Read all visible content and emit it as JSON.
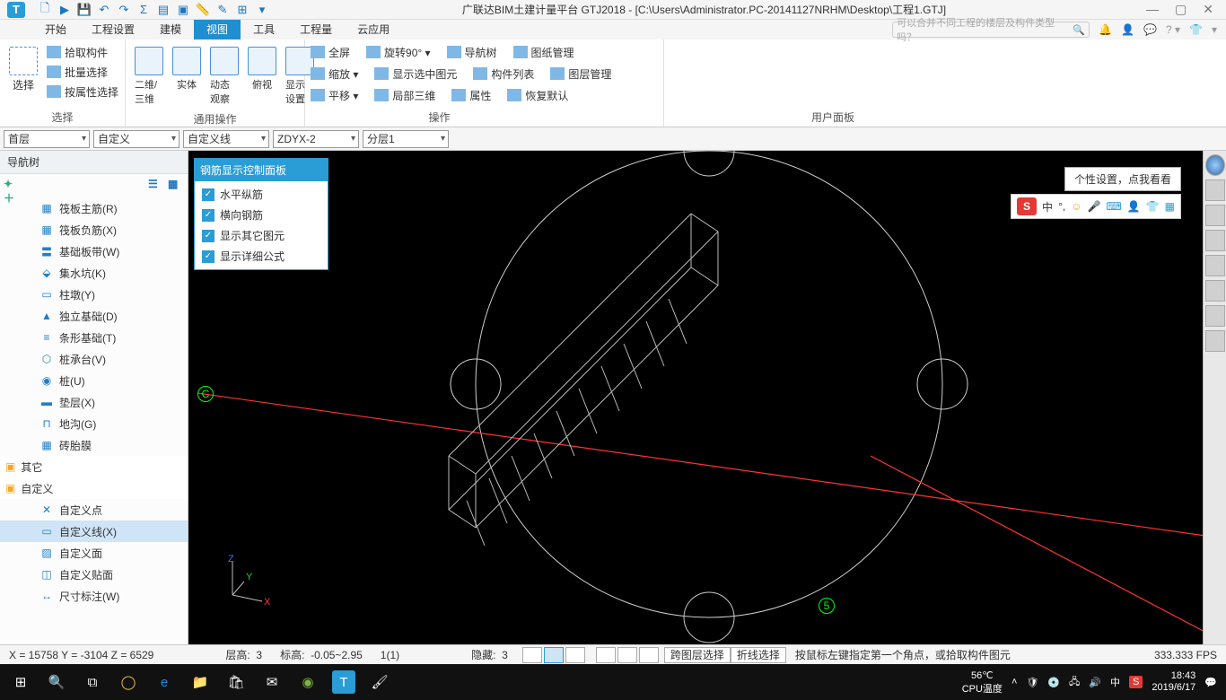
{
  "title": "广联达BIM土建计量平台 GTJ2018 - [C:\\Users\\Administrator.PC-20141127NRHM\\Desktop\\工程1.GTJ]",
  "menu": [
    "开始",
    "工程设置",
    "建模",
    "视图",
    "工具",
    "工程量",
    "云应用"
  ],
  "menu_active": 3,
  "search_placeholder": "可以合并不同工程的楼层及构件类型吗？",
  "ribbon": {
    "g1": {
      "label": "选择",
      "big": "选择",
      "items": [
        "拾取构件",
        "批量选择",
        "按属性选择"
      ]
    },
    "g2": {
      "label": "通用操作",
      "items": [
        "二维/三维",
        "实体",
        "动态观察",
        "俯视",
        "显示设置"
      ]
    },
    "g3": {
      "label": "操作",
      "r1": [
        "全屏",
        "旋转90° ▾",
        "导航树",
        "图纸管理"
      ],
      "r2": [
        "缩放 ▾",
        "显示选中图元",
        "构件列表",
        "图层管理"
      ],
      "r3": [
        "平移 ▾",
        "局部三维",
        "属性",
        "恢复默认"
      ]
    },
    "g4": {
      "label": "用户面板"
    }
  },
  "combos": {
    "floor": "首层",
    "c2": "自定义",
    "c3": "自定义线",
    "c4": "ZDYX-2",
    "c5": "分层1"
  },
  "nav_title": "导航树",
  "tree": [
    {
      "label": "筏板主筋(R)",
      "icon": "▦"
    },
    {
      "label": "筏板负筋(X)",
      "icon": "▦"
    },
    {
      "label": "基础板带(W)",
      "icon": "〓"
    },
    {
      "label": "集水坑(K)",
      "icon": "⬙"
    },
    {
      "label": "柱墩(Y)",
      "icon": "▭"
    },
    {
      "label": "独立基础(D)",
      "icon": "▲"
    },
    {
      "label": "条形基础(T)",
      "icon": "≡"
    },
    {
      "label": "桩承台(V)",
      "icon": "⬡"
    },
    {
      "label": "桩(U)",
      "icon": "◉"
    },
    {
      "label": "垫层(X)",
      "icon": "▬"
    },
    {
      "label": "地沟(G)",
      "icon": "⊓"
    },
    {
      "label": "砖胎膜",
      "icon": "▦"
    }
  ],
  "tree_cat1": "其它",
  "tree_cat2": "自定义",
  "tree2": [
    {
      "label": "自定义点",
      "icon": "✕",
      "sel": false
    },
    {
      "label": "自定义线(X)",
      "icon": "▭",
      "sel": true
    },
    {
      "label": "自定义面",
      "icon": "▨",
      "sel": false
    },
    {
      "label": "自定义贴面",
      "icon": "◫",
      "sel": false
    },
    {
      "label": "尺寸标注(W)",
      "icon": "↔",
      "sel": false
    }
  ],
  "rebar_panel": {
    "title": "钢筋显示控制面板",
    "items": [
      "水平纵筋",
      "横向钢筋",
      "显示其它图元",
      "显示详细公式"
    ]
  },
  "tooltip": "个性设置，点我看看",
  "ime": "中",
  "axis_c": "C",
  "axis_5": "5",
  "gizmo": {
    "x": "X",
    "y": "Y",
    "z": "Z"
  },
  "status": {
    "coords": "X = 15758 Y = -3104 Z = 6529",
    "floor_lbl": "层高:",
    "floor": "3",
    "elev_lbl": "标高:",
    "elev": "-0.05~2.95",
    "sel": "1(1)",
    "hide_lbl": "隐藏:",
    "hide": "3",
    "btns": [
      "跨图层选择",
      "折线选择"
    ],
    "hint": "按鼠标左键指定第一个角点，或拾取构件图元",
    "fps": "333.333 FPS"
  },
  "tray": {
    "temp": "56℃",
    "temp_lbl": "CPU温度",
    "time": "18:43",
    "date": "2019/6/17"
  }
}
